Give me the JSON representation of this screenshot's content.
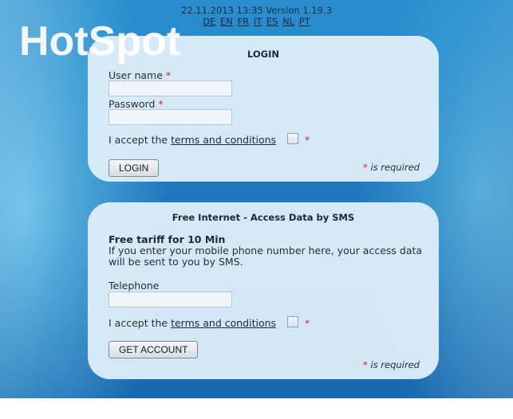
{
  "header": {
    "version_line": "22.11.2013 13:35 Version 1.19.3",
    "languages": [
      "DE",
      "EN",
      "FR",
      "IT",
      "ES",
      "NL",
      "PT"
    ]
  },
  "logo": {
    "text": "HotSpot"
  },
  "login": {
    "title": "LOGIN",
    "username_label": "User name",
    "username_value": "",
    "password_label": "Password",
    "password_value": "",
    "accept_prefix": "I accept the",
    "terms_link": "terms and conditions",
    "required_star": "*",
    "button": "LOGIN",
    "required_note": "is required"
  },
  "sms": {
    "title": "Free Internet - Access Data by SMS",
    "tariff": "Free tariff for 10 Min",
    "description": "If you enter your mobile phone number here, your access data will be sent to you by SMS.",
    "telephone_label": "Telephone",
    "telephone_value": "",
    "accept_prefix": "I accept the",
    "terms_link": "terms and conditions",
    "required_star": "*",
    "button": "GET ACCOUNT",
    "required_note": "is required"
  },
  "colors": {
    "background": "#1d78bd",
    "panel": "#e2f1fa",
    "required": "#d21f27"
  }
}
